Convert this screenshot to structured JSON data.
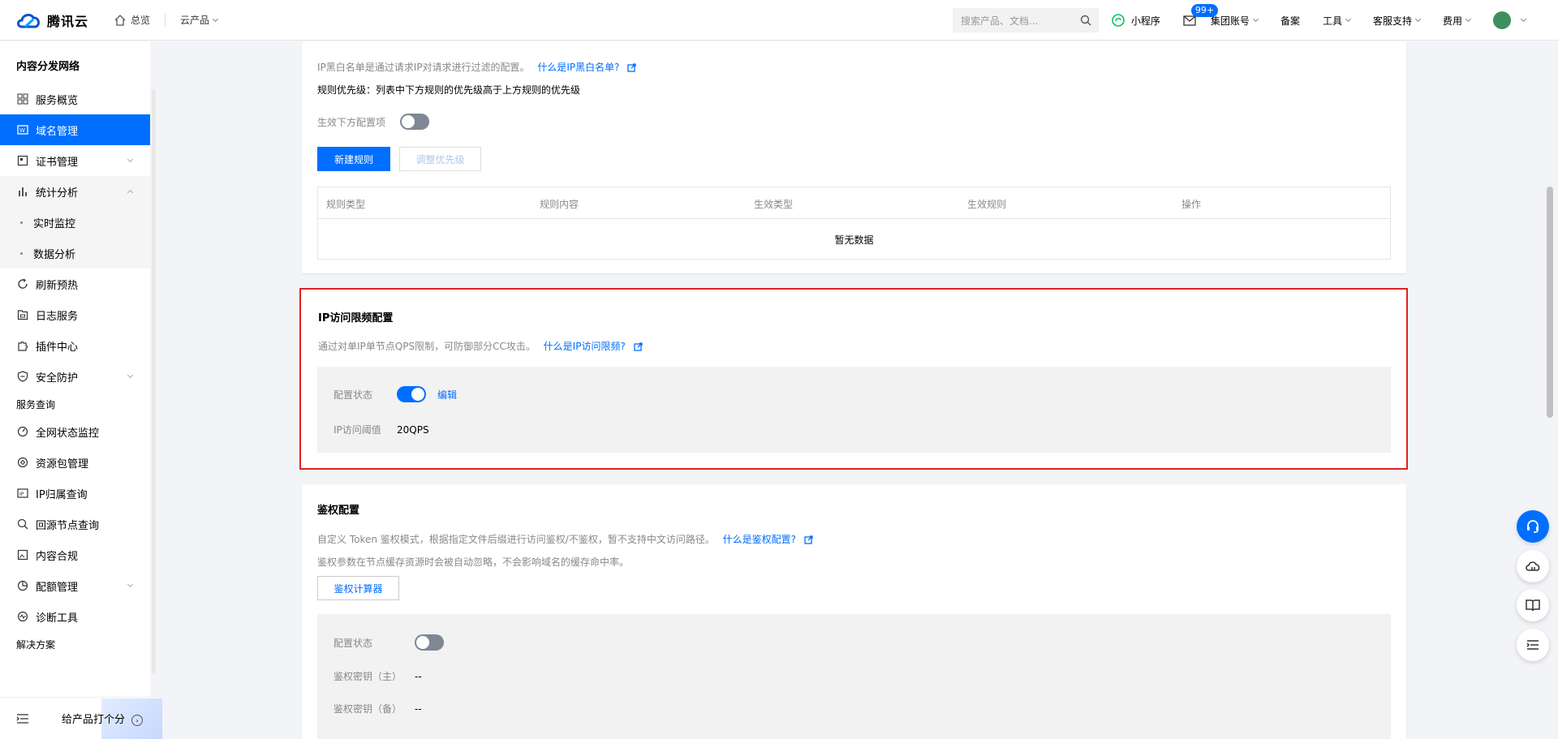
{
  "brand": {
    "name": "腾讯云"
  },
  "topbar": {
    "home": "总览",
    "products": "云产品",
    "search_placeholder": "搜索产品、文档...",
    "mini_program": "小程序",
    "mail_badge": "99+",
    "account": "集团账号",
    "beian": "备案",
    "tools": "工具",
    "support": "客服支持",
    "billing": "费用"
  },
  "sidebar": {
    "title": "内容分发网络",
    "items": [
      {
        "label": "服务概览"
      },
      {
        "label": "域名管理"
      },
      {
        "label": "证书管理"
      },
      {
        "label": "统计分析"
      },
      {
        "label": "实时监控"
      },
      {
        "label": "数据分析"
      },
      {
        "label": "刷新预热"
      },
      {
        "label": "日志服务"
      },
      {
        "label": "插件中心"
      },
      {
        "label": "安全防护"
      }
    ],
    "group_service": "服务查询",
    "service_items": [
      {
        "label": "全网状态监控"
      },
      {
        "label": "资源包管理"
      },
      {
        "label": "IP归属查询"
      },
      {
        "label": "回源节点查询"
      },
      {
        "label": "内容合规"
      },
      {
        "label": "配额管理"
      },
      {
        "label": "诊断工具"
      }
    ],
    "group_solution": "解决方案",
    "rate_label": "给产品打个分"
  },
  "ip_blacklist": {
    "desc": "IP黑白名单是通过请求IP对请求进行过滤的配置。",
    "link": "什么是IP黑白名单?",
    "priority": "规则优先级：列表中下方规则的优先级高于上方规则的优先级",
    "toggle_label": "生效下方配置项",
    "new_rule": "新建规则",
    "adjust_priority": "调整优先级",
    "columns": [
      "规则类型",
      "规则内容",
      "生效类型",
      "生效规则",
      "操作"
    ],
    "empty": "暂无数据"
  },
  "ip_rate": {
    "title": "IP访问限频配置",
    "desc": "通过对单IP单节点QPS限制，可防御部分CC攻击。",
    "link": "什么是IP访问限频?",
    "status_label": "配置状态",
    "edit": "编辑",
    "threshold_label": "IP访问阈值",
    "threshold_value": "20QPS"
  },
  "auth": {
    "title": "鉴权配置",
    "desc": "自定义 Token 鉴权模式，根据指定文件后缀进行访问鉴权/不鉴权，暂不支持中文访问路径。",
    "link": "什么是鉴权配置?",
    "note": "鉴权参数在节点缓存资源时会被自动忽略，不会影响域名的缓存命中率。",
    "calculator": "鉴权计算器",
    "status_label": "配置状态",
    "key_main_label": "鉴权密钥（主）",
    "key_main_value": "--",
    "key_backup_label": "鉴权密钥（备）",
    "key_backup_value": "--"
  },
  "colors": {
    "accent": "#006eff",
    "highlight_border": "#e02020"
  }
}
